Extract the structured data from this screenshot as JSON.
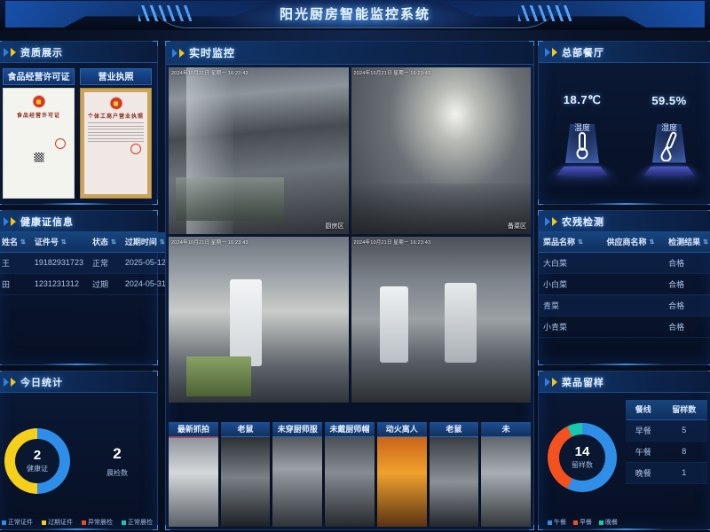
{
  "header": {
    "title": "阳光厨房智能监控系统"
  },
  "panels": {
    "qualification": {
      "title": "资质展示"
    },
    "health": {
      "title": "健康证信息"
    },
    "today": {
      "title": "今日统计"
    },
    "monitor": {
      "title": "实时监控"
    },
    "env": {
      "title": "总部餐厅"
    },
    "pesticide": {
      "title": "农残检测"
    },
    "sample": {
      "title": "菜品留样"
    }
  },
  "certificates": [
    {
      "caption": "食品经营许可证",
      "doc_title": "食品经营许可证"
    },
    {
      "caption": "营业执照",
      "doc_title": "个体工商户营业执照"
    }
  ],
  "health_table": {
    "columns": [
      "姓名",
      "证件号",
      "状态",
      "过期时间"
    ],
    "rows": [
      {
        "name": "王",
        "id": "19182931723",
        "status": "正常",
        "expire": "2025-05-12"
      },
      {
        "name": "田",
        "id": "1231231312",
        "status": "过期",
        "expire": "2024-05-31"
      }
    ]
  },
  "today_stats": {
    "health_cert": {
      "value": "2",
      "label": "健康证",
      "legend": [
        {
          "label": "正常证件",
          "color": "#2f8fe8"
        },
        {
          "label": "过期证件",
          "color": "#f5d01a"
        }
      ],
      "segments": [
        {
          "name": "正常证件",
          "value": 1,
          "color": "#2f8fe8"
        },
        {
          "name": "过期证件",
          "value": 1,
          "color": "#f5d01a"
        }
      ]
    },
    "morning_check": {
      "value": "2",
      "label": "晨检数",
      "legend": [
        {
          "label": "异常晨检",
          "color": "#ef4b23"
        },
        {
          "label": "正常晨检",
          "color": "#17c8c0"
        }
      ]
    }
  },
  "monitor": {
    "timestamp": "2024年10月21日 星期一 16:23:43",
    "videos": [
      {
        "zone": "厨房区",
        "timestamp": "2024年10月21日 星期一 16:23:43"
      },
      {
        "zone": "备菜区",
        "timestamp": "2024年10月21日 星期一 16:23:43"
      },
      {
        "zone": "",
        "timestamp": "2024年10月21日 星期一 16:23:43"
      },
      {
        "zone": "",
        "timestamp": "2024年10月21日 星期一 16:23:43"
      }
    ],
    "thumbnails": [
      {
        "label": "最新抓拍"
      },
      {
        "label": "老鼠"
      },
      {
        "label": "未穿厨师服"
      },
      {
        "label": "未戴厨师帽"
      },
      {
        "label": "动火离人"
      },
      {
        "label": "老鼠"
      },
      {
        "label": "未"
      }
    ]
  },
  "environment": [
    {
      "value": "18.7℃",
      "label": "温度",
      "icon": "thermometer-icon"
    },
    {
      "value": "59.5%",
      "label": "湿度",
      "icon": "humidity-icon"
    }
  ],
  "pesticide_table": {
    "columns": [
      "菜品名称",
      "供应商名称",
      "检测结果"
    ],
    "rows": [
      {
        "dish": "大白菜",
        "supplier": "",
        "result": "合格"
      },
      {
        "dish": "小白菜",
        "supplier": "",
        "result": "合格"
      },
      {
        "dish": "青菜",
        "supplier": "",
        "result": "合格"
      },
      {
        "dish": "小青菜",
        "supplier": "",
        "result": "合格"
      }
    ]
  },
  "sample_retention": {
    "total": "14",
    "total_label": "留样数",
    "legend": [
      {
        "label": "午餐",
        "color": "#2f8fe8"
      },
      {
        "label": "早餐",
        "color": "#f4511e"
      },
      {
        "label": "晚餐",
        "color": "#17c8ae"
      }
    ],
    "columns": [
      "餐线",
      "留样数"
    ],
    "rows": [
      {
        "meal": "早餐",
        "count": "5"
      },
      {
        "meal": "午餐",
        "count": "8"
      },
      {
        "meal": "晚餐",
        "count": "1"
      }
    ]
  },
  "chart_data": [
    {
      "type": "pie",
      "title": "健康证",
      "labels": [
        "正常证件",
        "过期证件"
      ],
      "values": [
        1,
        1
      ],
      "colors": [
        "#2f8fe8",
        "#f5d01a"
      ],
      "center_value": 2,
      "legend_position": "bottom"
    },
    {
      "type": "pie",
      "title": "留样数",
      "labels": [
        "午餐",
        "早餐",
        "晚餐"
      ],
      "values": [
        8,
        5,
        1
      ],
      "colors": [
        "#2f8fe8",
        "#f4511e",
        "#17c8ae"
      ],
      "center_value": 14,
      "legend_position": "bottom"
    }
  ]
}
